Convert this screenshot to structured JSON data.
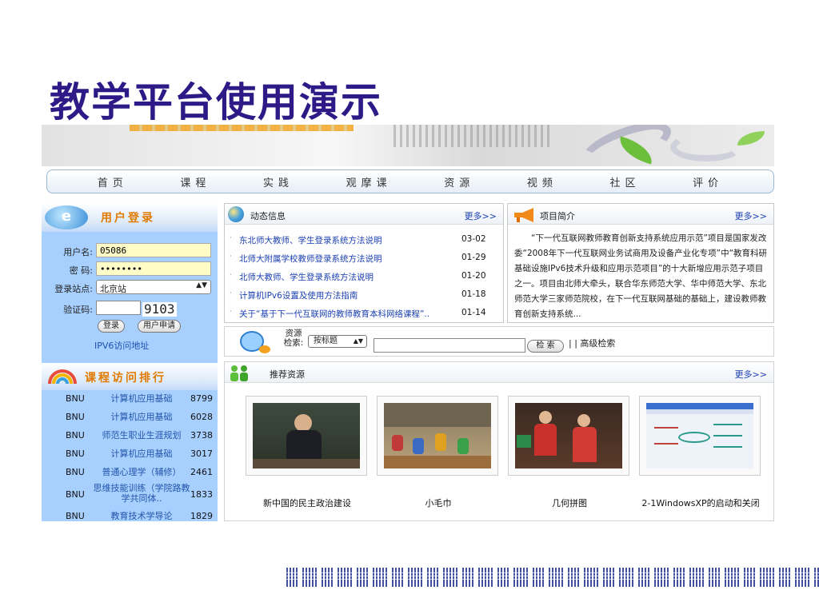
{
  "slide": {
    "title": "教学平台使用演示"
  },
  "nav": {
    "items": [
      "首页",
      "课程",
      "实践",
      "观摩课",
      "资源",
      "视频",
      "社区",
      "评价"
    ]
  },
  "login": {
    "title": "用户登录",
    "badge": "e",
    "username_label": "用户名:",
    "username_value": "05086",
    "password_label": "密  码:",
    "password_value": "••••••••",
    "site_label": "登录站点:",
    "site_value": "北京站",
    "captcha_label": "验证码:",
    "captcha_code": "9103",
    "login_button": "登录",
    "register_button": "用户申请",
    "ipv6_link": "IPV6访问地址"
  },
  "ranking": {
    "title": "课程访问排行",
    "rows": [
      {
        "org": "BNU",
        "name": "计算机应用基础",
        "count": "8799"
      },
      {
        "org": "BNU",
        "name": "计算机应用基础",
        "count": "6028"
      },
      {
        "org": "BNU",
        "name": "师范生职业生涯规划",
        "count": "3738"
      },
      {
        "org": "BNU",
        "name": "计算机应用基础",
        "count": "3017"
      },
      {
        "org": "BNU",
        "name": "普通心理学（辅修）",
        "count": "2461"
      },
      {
        "org": "BNU",
        "name": "思维技能训练（学院路教学共同体..",
        "count": "1833"
      },
      {
        "org": "BNU",
        "name": "教育技术学导论",
        "count": "1829"
      }
    ]
  },
  "news": {
    "title": "动态信息",
    "more": "更多>>",
    "items": [
      {
        "text": "东北师大教师、学生登录系统方法说明",
        "date": "03-02"
      },
      {
        "text": "北师大附属学校教师登录系统方法说明",
        "date": "01-29"
      },
      {
        "text": "北师大教师、学生登录系统方法说明",
        "date": "01-20"
      },
      {
        "text": "计算机IPv6设置及使用方法指南",
        "date": "01-18"
      },
      {
        "text": "关于“基于下一代互联网的教师教育本科网络课程”..",
        "date": "01-14"
      }
    ]
  },
  "intro": {
    "title": "项目简介",
    "more": "更多>>",
    "text": "“下一代互联网教师教育创新支持系统应用示范”项目是国家发改委“2008年下一代互联网业务试商用及设备产业化专项”中“教育科研基础设施IPv6技术升级和应用示范项目”的十大新增应用示范子项目之一。项目由北师大牵头，联合华东师范大学、华中师范大学、东北师范大学三家师范院校，在下一代互联网基础的基础上，建设教师教育创新支持系统..."
  },
  "search": {
    "label": "资源检索:",
    "select_value": "按标题",
    "button": "检 索",
    "advanced": "| | 高级检索"
  },
  "recommend": {
    "title": "推荐资源",
    "more": "更多>>",
    "items": [
      {
        "caption": "新中国的民主政治建设"
      },
      {
        "caption": "小毛巾"
      },
      {
        "caption": "几何拼图"
      },
      {
        "caption": "2-1WindowsXP的启动和关闭"
      }
    ]
  },
  "colors": {
    "title": "#2e1a86",
    "left_panel": "#a8d0ff",
    "link": "#1a3fb0",
    "accent_orange": "#e07a00"
  }
}
